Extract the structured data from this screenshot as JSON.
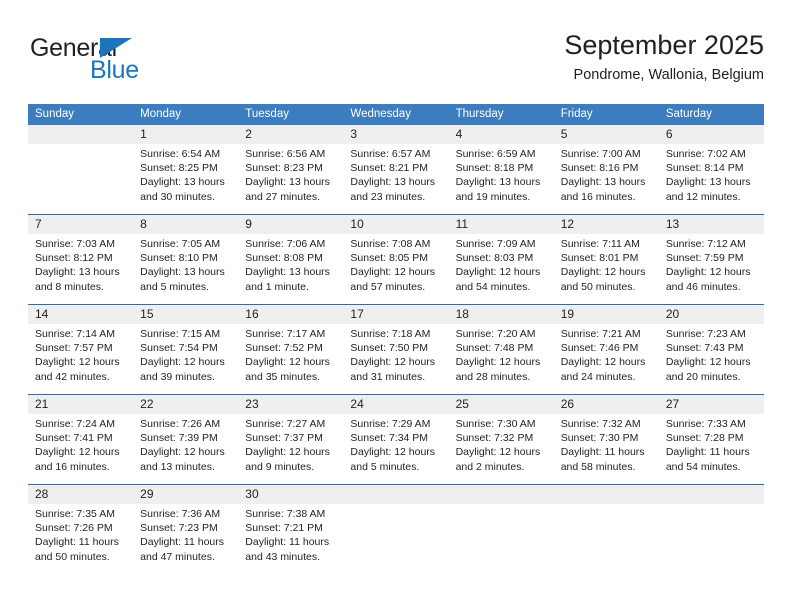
{
  "logo": {
    "word_top": "General",
    "word_bottom": "Blue",
    "triangle_icon": "blue-triangle-icon",
    "accent_color": "#1c75bc"
  },
  "header": {
    "title": "September 2025",
    "subtitle": "Pondrome, Wallonia, Belgium"
  },
  "colors": {
    "header_blue": "#3b7dbf",
    "daynum_band": "#efefef",
    "week_divider": "#2f6da8",
    "text": "#231f20"
  },
  "weekdays": [
    "Sunday",
    "Monday",
    "Tuesday",
    "Wednesday",
    "Thursday",
    "Friday",
    "Saturday"
  ],
  "weeks": [
    [
      {
        "day": ""
      },
      {
        "day": "1",
        "sunrise": "Sunrise: 6:54 AM",
        "sunset": "Sunset: 8:25 PM",
        "daylight": "Daylight: 13 hours and 30 minutes."
      },
      {
        "day": "2",
        "sunrise": "Sunrise: 6:56 AM",
        "sunset": "Sunset: 8:23 PM",
        "daylight": "Daylight: 13 hours and 27 minutes."
      },
      {
        "day": "3",
        "sunrise": "Sunrise: 6:57 AM",
        "sunset": "Sunset: 8:21 PM",
        "daylight": "Daylight: 13 hours and 23 minutes."
      },
      {
        "day": "4",
        "sunrise": "Sunrise: 6:59 AM",
        "sunset": "Sunset: 8:18 PM",
        "daylight": "Daylight: 13 hours and 19 minutes."
      },
      {
        "day": "5",
        "sunrise": "Sunrise: 7:00 AM",
        "sunset": "Sunset: 8:16 PM",
        "daylight": "Daylight: 13 hours and 16 minutes."
      },
      {
        "day": "6",
        "sunrise": "Sunrise: 7:02 AM",
        "sunset": "Sunset: 8:14 PM",
        "daylight": "Daylight: 13 hours and 12 minutes."
      }
    ],
    [
      {
        "day": "7",
        "sunrise": "Sunrise: 7:03 AM",
        "sunset": "Sunset: 8:12 PM",
        "daylight": "Daylight: 13 hours and 8 minutes."
      },
      {
        "day": "8",
        "sunrise": "Sunrise: 7:05 AM",
        "sunset": "Sunset: 8:10 PM",
        "daylight": "Daylight: 13 hours and 5 minutes."
      },
      {
        "day": "9",
        "sunrise": "Sunrise: 7:06 AM",
        "sunset": "Sunset: 8:08 PM",
        "daylight": "Daylight: 13 hours and 1 minute."
      },
      {
        "day": "10",
        "sunrise": "Sunrise: 7:08 AM",
        "sunset": "Sunset: 8:05 PM",
        "daylight": "Daylight: 12 hours and 57 minutes."
      },
      {
        "day": "11",
        "sunrise": "Sunrise: 7:09 AM",
        "sunset": "Sunset: 8:03 PM",
        "daylight": "Daylight: 12 hours and 54 minutes."
      },
      {
        "day": "12",
        "sunrise": "Sunrise: 7:11 AM",
        "sunset": "Sunset: 8:01 PM",
        "daylight": "Daylight: 12 hours and 50 minutes."
      },
      {
        "day": "13",
        "sunrise": "Sunrise: 7:12 AM",
        "sunset": "Sunset: 7:59 PM",
        "daylight": "Daylight: 12 hours and 46 minutes."
      }
    ],
    [
      {
        "day": "14",
        "sunrise": "Sunrise: 7:14 AM",
        "sunset": "Sunset: 7:57 PM",
        "daylight": "Daylight: 12 hours and 42 minutes."
      },
      {
        "day": "15",
        "sunrise": "Sunrise: 7:15 AM",
        "sunset": "Sunset: 7:54 PM",
        "daylight": "Daylight: 12 hours and 39 minutes."
      },
      {
        "day": "16",
        "sunrise": "Sunrise: 7:17 AM",
        "sunset": "Sunset: 7:52 PM",
        "daylight": "Daylight: 12 hours and 35 minutes."
      },
      {
        "day": "17",
        "sunrise": "Sunrise: 7:18 AM",
        "sunset": "Sunset: 7:50 PM",
        "daylight": "Daylight: 12 hours and 31 minutes."
      },
      {
        "day": "18",
        "sunrise": "Sunrise: 7:20 AM",
        "sunset": "Sunset: 7:48 PM",
        "daylight": "Daylight: 12 hours and 28 minutes."
      },
      {
        "day": "19",
        "sunrise": "Sunrise: 7:21 AM",
        "sunset": "Sunset: 7:46 PM",
        "daylight": "Daylight: 12 hours and 24 minutes."
      },
      {
        "day": "20",
        "sunrise": "Sunrise: 7:23 AM",
        "sunset": "Sunset: 7:43 PM",
        "daylight": "Daylight: 12 hours and 20 minutes."
      }
    ],
    [
      {
        "day": "21",
        "sunrise": "Sunrise: 7:24 AM",
        "sunset": "Sunset: 7:41 PM",
        "daylight": "Daylight: 12 hours and 16 minutes."
      },
      {
        "day": "22",
        "sunrise": "Sunrise: 7:26 AM",
        "sunset": "Sunset: 7:39 PM",
        "daylight": "Daylight: 12 hours and 13 minutes."
      },
      {
        "day": "23",
        "sunrise": "Sunrise: 7:27 AM",
        "sunset": "Sunset: 7:37 PM",
        "daylight": "Daylight: 12 hours and 9 minutes."
      },
      {
        "day": "24",
        "sunrise": "Sunrise: 7:29 AM",
        "sunset": "Sunset: 7:34 PM",
        "daylight": "Daylight: 12 hours and 5 minutes."
      },
      {
        "day": "25",
        "sunrise": "Sunrise: 7:30 AM",
        "sunset": "Sunset: 7:32 PM",
        "daylight": "Daylight: 12 hours and 2 minutes."
      },
      {
        "day": "26",
        "sunrise": "Sunrise: 7:32 AM",
        "sunset": "Sunset: 7:30 PM",
        "daylight": "Daylight: 11 hours and 58 minutes."
      },
      {
        "day": "27",
        "sunrise": "Sunrise: 7:33 AM",
        "sunset": "Sunset: 7:28 PM",
        "daylight": "Daylight: 11 hours and 54 minutes."
      }
    ],
    [
      {
        "day": "28",
        "sunrise": "Sunrise: 7:35 AM",
        "sunset": "Sunset: 7:26 PM",
        "daylight": "Daylight: 11 hours and 50 minutes."
      },
      {
        "day": "29",
        "sunrise": "Sunrise: 7:36 AM",
        "sunset": "Sunset: 7:23 PM",
        "daylight": "Daylight: 11 hours and 47 minutes."
      },
      {
        "day": "30",
        "sunrise": "Sunrise: 7:38 AM",
        "sunset": "Sunset: 7:21 PM",
        "daylight": "Daylight: 11 hours and 43 minutes."
      },
      {
        "day": ""
      },
      {
        "day": ""
      },
      {
        "day": ""
      },
      {
        "day": ""
      }
    ]
  ]
}
